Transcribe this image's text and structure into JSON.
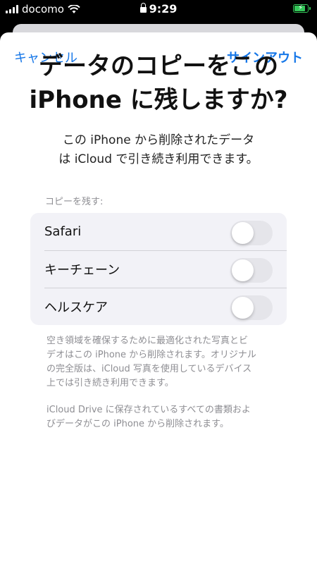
{
  "status_bar": {
    "carrier": "docomo",
    "time": "9:29",
    "battery_fill": 0.9
  },
  "nav": {
    "cancel_label": "キャンセル",
    "signout_label": "サインアウト"
  },
  "title": {
    "line1": "データのコピーをこの",
    "line2": "iPhone に残しますか?"
  },
  "subtitle": {
    "line1": "この iPhone から削除されたデータ",
    "line2": "は iCloud で引き続き利用できます。"
  },
  "section_label": "コピーを残す:",
  "items": [
    {
      "label": "Safari",
      "on": false
    },
    {
      "label": "キーチェーン",
      "on": false
    },
    {
      "label": "ヘルスケア",
      "on": false
    }
  ],
  "notes": {
    "note1": [
      "空き領域を確保するために最適化された写真とビ",
      "デオはこの iPhone から削除されます。オリジナル",
      "の完全版は、iCloud 写真を使用しているデバイス",
      "上では引き続き利用できます。"
    ],
    "note2": [
      "iCloud Drive に保存されているすべての書類およ",
      "びデータがこの iPhone から削除されます。"
    ]
  },
  "colors": {
    "accent": "#1677e8",
    "battery": "#34c759",
    "toggle_off": "#e5e5ea"
  }
}
